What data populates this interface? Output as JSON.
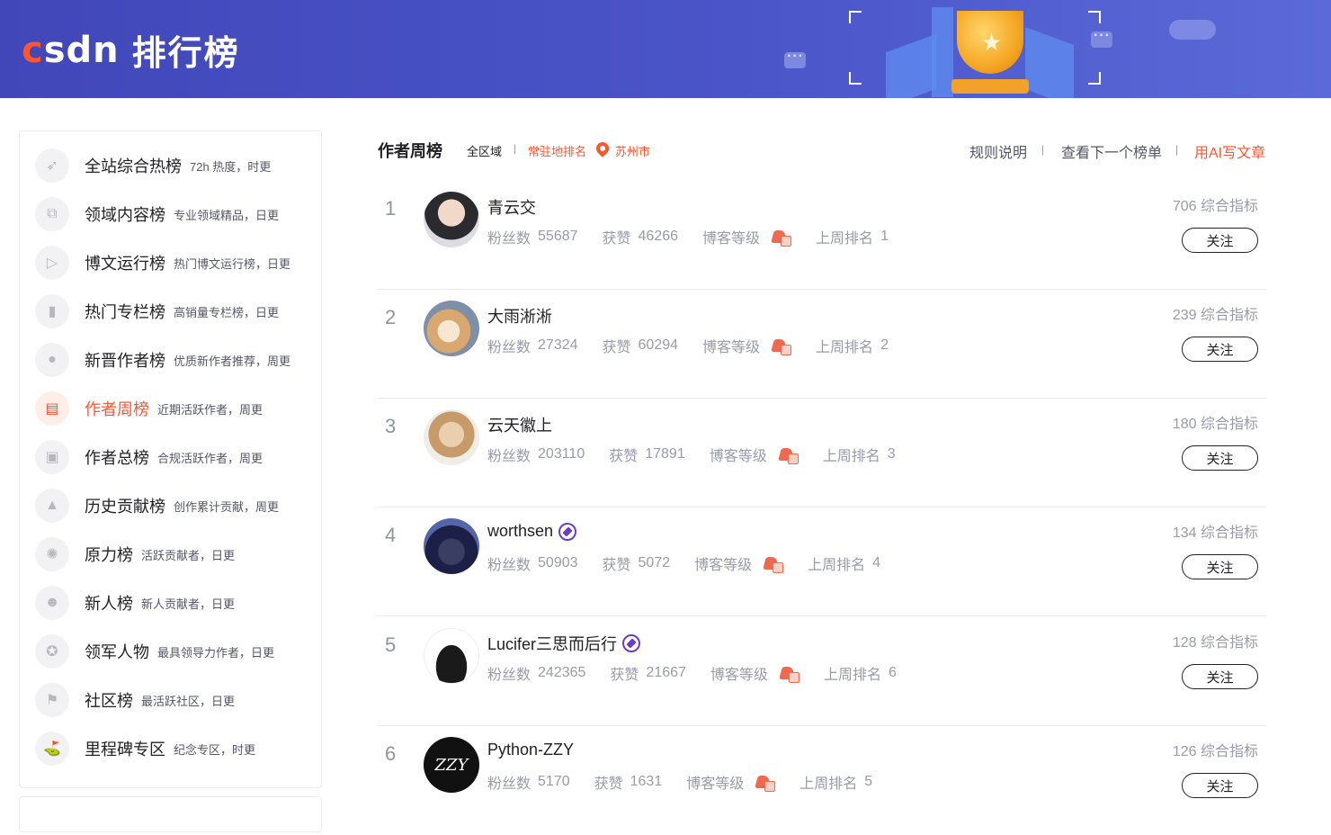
{
  "brand": {
    "logo_c": "c",
    "logo_rest": "sdn",
    "title": "排行榜"
  },
  "sidebar": {
    "items": [
      {
        "name": "全站综合热榜",
        "desc": "72h 热度，时更",
        "icon": "rocket-icon",
        "active": false
      },
      {
        "name": "领域内容榜",
        "desc": "专业领域精品，日更",
        "icon": "code-icon",
        "active": false
      },
      {
        "name": "博文运行榜",
        "desc": "热门博文运行榜，日更",
        "icon": "play-icon",
        "active": false
      },
      {
        "name": "热门专栏榜",
        "desc": "高销量专栏榜，日更",
        "icon": "bookmark-icon",
        "active": false
      },
      {
        "name": "新晋作者榜",
        "desc": "优质新作者推荐，周更",
        "icon": "user-icon",
        "active": false
      },
      {
        "name": "作者周榜",
        "desc": "近期活跃作者，周更",
        "icon": "calendar-icon",
        "active": true
      },
      {
        "name": "作者总榜",
        "desc": "合规活跃作者，周更",
        "icon": "users-icon",
        "active": false
      },
      {
        "name": "历史贡献榜",
        "desc": "创作累计贡献，周更",
        "icon": "contribution-icon",
        "active": false
      },
      {
        "name": "原力榜",
        "desc": "活跃贡献者，日更",
        "icon": "force-icon",
        "active": false
      },
      {
        "name": "新人榜",
        "desc": "新人贡献者，日更",
        "icon": "newbie-icon",
        "active": false
      },
      {
        "name": "领军人物",
        "desc": "最具领导力作者，日更",
        "icon": "medal-icon",
        "active": false
      },
      {
        "name": "社区榜",
        "desc": "最活跃社区，日更",
        "icon": "flag-icon",
        "active": false
      },
      {
        "name": "里程碑专区",
        "desc": "纪念专区，时更",
        "icon": "milestone-icon",
        "active": false
      }
    ]
  },
  "header": {
    "title": "作者周榜",
    "region": "全区域",
    "local_rank": "常驻地排名",
    "city": "苏州市",
    "rules": "规则说明",
    "next_list": "查看下一个榜单",
    "ai_write": "用AI写文章"
  },
  "labels": {
    "fans": "粉丝数",
    "likes": "获赞",
    "level": "博客等级",
    "last_rank": "上周排名",
    "score_suffix": "综合指标",
    "follow": "关注"
  },
  "ranking": [
    {
      "rank": "1",
      "name": "青云交",
      "fans": "55687",
      "likes": "46266",
      "last_rank": "1",
      "score": "706",
      "badge": false
    },
    {
      "rank": "2",
      "name": "大雨淅淅",
      "fans": "27324",
      "likes": "60294",
      "last_rank": "2",
      "score": "239",
      "badge": false
    },
    {
      "rank": "3",
      "name": "云天徽上",
      "fans": "203110",
      "likes": "17891",
      "last_rank": "3",
      "score": "180",
      "badge": false
    },
    {
      "rank": "4",
      "name": "worthsen",
      "fans": "50903",
      "likes": "5072",
      "last_rank": "4",
      "score": "134",
      "badge": true
    },
    {
      "rank": "5",
      "name": "Lucifer三思而后行",
      "fans": "242365",
      "likes": "21667",
      "last_rank": "6",
      "score": "128",
      "badge": true
    },
    {
      "rank": "6",
      "name": "Python-ZZY",
      "fans": "5170",
      "likes": "1631",
      "last_rank": "5",
      "score": "126",
      "badge": false
    }
  ],
  "avatar_text": {
    "zzy": "ZZY"
  }
}
